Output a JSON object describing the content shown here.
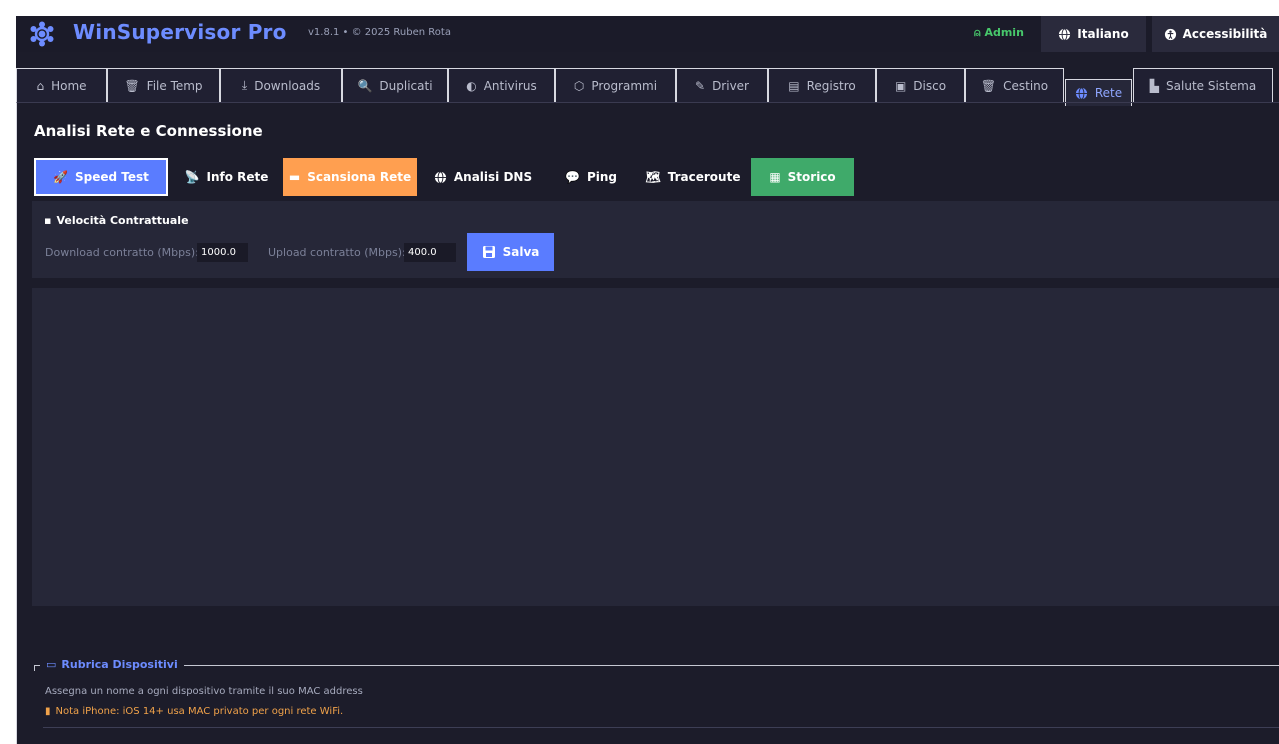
{
  "header": {
    "title": "WinSupervisor Pro",
    "version": "v1.8.1 • © 2025 Ruben Rota",
    "admin_label": "Admin",
    "language_label": "Italiano",
    "accessibility_label": "Accessibilità"
  },
  "tabs": [
    {
      "label": "Home",
      "icon": "home-icon"
    },
    {
      "label": "File Temp",
      "icon": "trash-icon"
    },
    {
      "label": "Downloads",
      "icon": "download-icon"
    },
    {
      "label": "Duplicati",
      "icon": "magnifier-icon"
    },
    {
      "label": "Antivirus",
      "icon": "shield-icon"
    },
    {
      "label": "Programmi",
      "icon": "package-icon"
    },
    {
      "label": "Driver",
      "icon": "wrench-icon"
    },
    {
      "label": "Registro",
      "icon": "registry-icon"
    },
    {
      "label": "Disco",
      "icon": "disk-icon"
    },
    {
      "label": "Cestino",
      "icon": "bin-icon"
    },
    {
      "label": "Rete",
      "icon": "globe-icon",
      "active": true
    },
    {
      "label": "Salute Sistema",
      "icon": "health-icon"
    }
  ],
  "network": {
    "title": "Analisi Rete e Connessione",
    "subtabs": [
      {
        "label": "Speed Test",
        "icon": "rocket-icon"
      },
      {
        "label": "Info Rete",
        "icon": "satellite-icon"
      },
      {
        "label": "Scansiona Rete",
        "icon": "scan-icon"
      },
      {
        "label": "Analisi DNS",
        "icon": "globe-icon"
      },
      {
        "label": "Ping",
        "icon": "chat-icon"
      },
      {
        "label": "Traceroute",
        "icon": "map-icon"
      },
      {
        "label": "Storico",
        "icon": "chart-icon"
      }
    ],
    "contract": {
      "title": "Velocità Contrattuale",
      "download_label": "Download contratto (Mbps):",
      "download_value": "1000.0",
      "upload_label": "Upload contratto (Mbps):",
      "upload_value": "400.0",
      "save_label": "Salva"
    }
  },
  "device_book": {
    "title": "Rubrica Dispositivi",
    "description": "Assegna un nome a ogni dispositivo tramite il suo MAC address",
    "note": "Nota iPhone: iOS 14+ usa MAC privato per ogni rete WiFi."
  },
  "colors": {
    "accent": "#5a7cff",
    "orange": "#ff9f50",
    "green": "#3faa6a",
    "background": "#1c1c2a"
  }
}
